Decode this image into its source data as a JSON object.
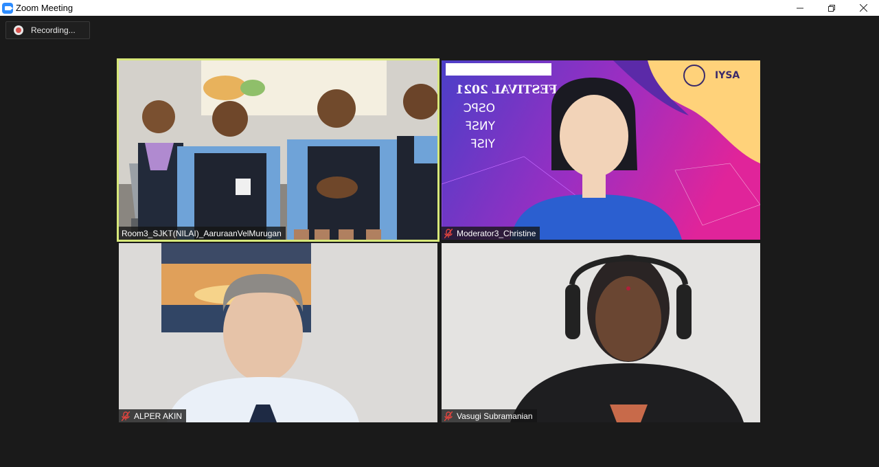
{
  "window": {
    "title": "Zoom Meeting",
    "controls": {
      "minimize": "—",
      "restore": "❐",
      "close": "✕"
    }
  },
  "recording": {
    "label": "Recording..."
  },
  "participants": [
    {
      "name": "Room3_SJKT(NILAI)_AaruraanVelMurugan",
      "muted": false,
      "active_speaker": true
    },
    {
      "name": "Moderator3_Christine",
      "muted": true,
      "active_speaker": false
    },
    {
      "name": "ALPER AKIN",
      "muted": true,
      "active_speaker": false
    },
    {
      "name": "Vasugi Subramanian",
      "muted": true,
      "active_speaker": false
    }
  ],
  "background_banner": {
    "title": "IYSA FESTIVAL 2021",
    "lines": [
      "OSPC",
      "YNSF",
      "YISF"
    ],
    "logo_text": "IYSA"
  },
  "colors": {
    "active_speaker_outline": "#d7e87a",
    "stage_bg": "#1a1a1a",
    "zoom_blue": "#2d8cff",
    "mute_red": "#e0443e"
  }
}
